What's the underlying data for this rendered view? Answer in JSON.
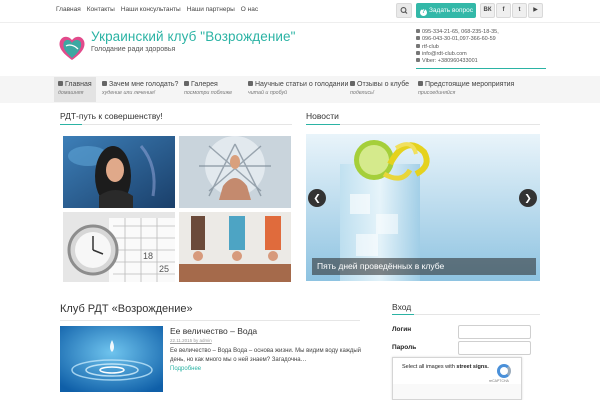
{
  "top_nav": {
    "links": [
      "Главная",
      "Контакты",
      "Наши консультанты",
      "Наши партнеры",
      "О нас"
    ],
    "ask_button": "Задать вопрос",
    "social": [
      "ВК",
      "f",
      "t",
      "▶"
    ]
  },
  "header": {
    "title": "Украинский клуб \"Возрождение\"",
    "subtitle": "Голодание ради здоровья",
    "contacts": [
      "095-334-21-65, 068-235-18-35,",
      "096-043-30-01,097-366-60-59",
      "rtf-club",
      "info@rdt-club.com",
      "Viber: +380960433001"
    ]
  },
  "menu": [
    {
      "label": "Главная",
      "sub": "домашняя"
    },
    {
      "label": "Зачем мне голодать?",
      "sub": "худение или лечение!"
    },
    {
      "label": "Галерея",
      "sub": "посмотри поближе"
    },
    {
      "label": "Научные статьи о голодании",
      "sub": "читай и пробуй"
    },
    {
      "label": "Отзывы о клубе",
      "sub": "поделись!"
    },
    {
      "label": "Предстоящие мероприятия",
      "sub": "присоединяйся"
    }
  ],
  "sections": {
    "left_title": "РДТ-путь к совершенству!",
    "right_title": "Новости"
  },
  "slider": {
    "caption": "Пять дней проведённых в клубе",
    "prev": "❮",
    "next": "❯"
  },
  "club": {
    "title": "Клуб РДТ «Возрождение»",
    "post_title": "Ее величество – Вода",
    "post_meta": "22.11.2015 by admin",
    "post_excerpt": "Ее величество – Вода Вода – основа жизни. Мы видим воду каждый день, но как много мы о ней знаем? Загадочна…",
    "post_more": "Подробнее"
  },
  "login": {
    "title": "Вход",
    "login_label": "Логин",
    "password_label": "Пароль",
    "captcha_line1": "Select all images with",
    "captcha_bold": "street signs.",
    "captcha_brand": "reCAPTCHA"
  },
  "colors": {
    "accent": "#2bb3a4",
    "button": "#33b8a8"
  }
}
